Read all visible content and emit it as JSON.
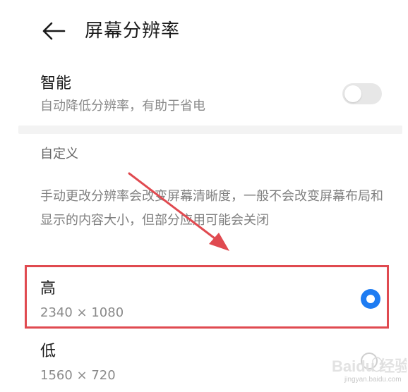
{
  "header": {
    "back_icon": "arrow-left-icon",
    "title": "屏幕分辨率"
  },
  "smart": {
    "title": "智能",
    "description": "自动降低分辨率，有助于省电",
    "toggle_on": false
  },
  "custom": {
    "label": "自定义",
    "description": "手动更改分辨率会改变屏幕清晰度，一般不会改变屏幕布局和显示的内容大小，但部分应用可能会关闭"
  },
  "options": [
    {
      "name": "高",
      "resolution": "2340 × 1080",
      "selected": true
    },
    {
      "name": "低",
      "resolution": "1560 × 720",
      "selected": false
    }
  ],
  "watermark": {
    "logo": "Baidu 经验",
    "sub": "jingyan.baidu.com"
  },
  "colors": {
    "accent": "#1e7cf2",
    "annotation_red": "#e04a50",
    "toggle_off": "#e7e7e7"
  }
}
